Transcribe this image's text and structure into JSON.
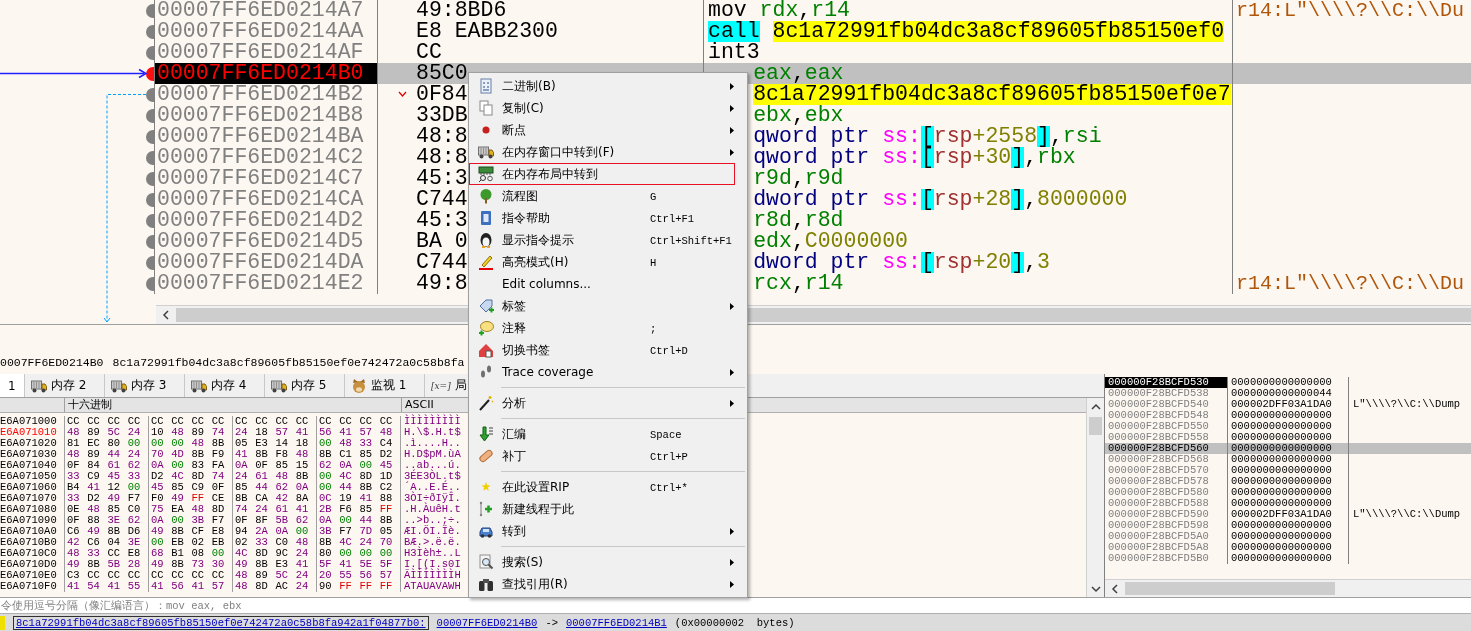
{
  "disassembly": {
    "rows": [
      {
        "address": "00007FF6ED0214A7",
        "bytes": "49:8BD6",
        "selected": false,
        "jump": false,
        "mnemonic": {
          "text": "mov",
          "kind": "plain"
        },
        "operands": [
          {
            "text": "rdx",
            "kind": "reg"
          },
          {
            "text": ",",
            "kind": "punct"
          },
          {
            "text": "r14",
            "kind": "reg"
          }
        ],
        "comment": "r14:L\"\\\\\\\\?\\\\C:\\\\Du"
      },
      {
        "address": "00007FF6ED0214AA",
        "bytes": "E8 EABB2300",
        "selected": false,
        "jump": false,
        "mnemonic": {
          "text": "call",
          "kind": "call"
        },
        "operands": [
          {
            "text": "8c1a72991fb04dc3a8cf89605fb85150ef0",
            "kind": "target"
          }
        ]
      },
      {
        "address": "00007FF6ED0214AF",
        "bytes": "CC",
        "selected": false,
        "jump": false,
        "mnemonic": {
          "text": "int3",
          "kind": "plain"
        }
      },
      {
        "address": "00007FF6ED0214B0",
        "bytes": "85C0",
        "selected": true,
        "jump": false,
        "operands": [
          {
            "text": "eax",
            "kind": "reg"
          },
          {
            "text": ",",
            "kind": "punct"
          },
          {
            "text": "eax",
            "kind": "reg"
          }
        ]
      },
      {
        "address": "00007FF6ED0214B2",
        "bytes": "0F84",
        "selected": false,
        "jump": true,
        "operands": [
          {
            "text": "8c1a72991fb04dc3a8cf89605fb85150ef0e7",
            "kind": "target"
          }
        ]
      },
      {
        "address": "00007FF6ED0214B8",
        "bytes": "33DB",
        "selected": false,
        "jump": false,
        "operands": [
          {
            "text": "ebx",
            "kind": "reg"
          },
          {
            "text": ",",
            "kind": "punct"
          },
          {
            "text": "ebx",
            "kind": "reg"
          }
        ]
      },
      {
        "address": "00007FF6ED0214BA",
        "bytes": "48:8",
        "selected": false,
        "jump": false,
        "operands": [
          {
            "text": "qword ptr ",
            "kind": "size"
          },
          {
            "text": "ss:",
            "kind": "seg"
          },
          {
            "text": "[",
            "kind": "bracket"
          },
          {
            "text": "rsp",
            "kind": "memreg"
          },
          {
            "text": "+2558",
            "kind": "num"
          },
          {
            "text": "]",
            "kind": "bracket"
          },
          {
            "text": ",",
            "kind": "punct"
          },
          {
            "text": "rsi",
            "kind": "reg"
          }
        ]
      },
      {
        "address": "00007FF6ED0214C2",
        "bytes": "48:8",
        "selected": false,
        "jump": false,
        "operands": [
          {
            "text": "qword ptr ",
            "kind": "size"
          },
          {
            "text": "ss:",
            "kind": "seg"
          },
          {
            "text": "[",
            "kind": "bracket"
          },
          {
            "text": "rsp",
            "kind": "memreg"
          },
          {
            "text": "+30",
            "kind": "num"
          },
          {
            "text": "]",
            "kind": "bracket"
          },
          {
            "text": ",",
            "kind": "punct"
          },
          {
            "text": "rbx",
            "kind": "reg"
          }
        ]
      },
      {
        "address": "00007FF6ED0214C7",
        "bytes": "45:3",
        "selected": false,
        "jump": false,
        "operands": [
          {
            "text": "r9d",
            "kind": "reg"
          },
          {
            "text": ",",
            "kind": "punct"
          },
          {
            "text": "r9d",
            "kind": "reg"
          }
        ]
      },
      {
        "address": "00007FF6ED0214CA",
        "bytes": "C744",
        "selected": false,
        "jump": false,
        "operands": [
          {
            "text": "dword ptr ",
            "kind": "size"
          },
          {
            "text": "ss:",
            "kind": "seg"
          },
          {
            "text": "[",
            "kind": "bracket"
          },
          {
            "text": "rsp",
            "kind": "memreg"
          },
          {
            "text": "+28",
            "kind": "num"
          },
          {
            "text": "]",
            "kind": "bracket"
          },
          {
            "text": ",",
            "kind": "punct"
          },
          {
            "text": "8000000",
            "kind": "num"
          }
        ]
      },
      {
        "address": "00007FF6ED0214D2",
        "bytes": "45:3",
        "selected": false,
        "jump": false,
        "operands": [
          {
            "text": "r8d",
            "kind": "reg"
          },
          {
            "text": ",",
            "kind": "punct"
          },
          {
            "text": "r8d",
            "kind": "reg"
          }
        ]
      },
      {
        "address": "00007FF6ED0214D5",
        "bytes": "BA 0",
        "selected": false,
        "jump": false,
        "operands": [
          {
            "text": "edx",
            "kind": "reg"
          },
          {
            "text": ",",
            "kind": "punct"
          },
          {
            "text": "C0000000",
            "kind": "num"
          }
        ]
      },
      {
        "address": "00007FF6ED0214DA",
        "bytes": "C744",
        "selected": false,
        "jump": false,
        "operands": [
          {
            "text": "dword ptr ",
            "kind": "size"
          },
          {
            "text": "ss:",
            "kind": "seg"
          },
          {
            "text": "[",
            "kind": "bracket"
          },
          {
            "text": "rsp",
            "kind": "memreg"
          },
          {
            "text": "+20",
            "kind": "num"
          },
          {
            "text": "]",
            "kind": "bracket"
          },
          {
            "text": ",",
            "kind": "punct"
          },
          {
            "text": "3",
            "kind": "num"
          }
        ]
      },
      {
        "address": "00007FF6ED0214E2",
        "bytes": "49:8",
        "selected": false,
        "jump": false,
        "operands": [
          {
            "text": "rcx",
            "kind": "reg"
          },
          {
            "text": ",",
            "kind": "punct"
          },
          {
            "text": "r14",
            "kind": "reg"
          }
        ],
        "comment": "r14:L\"\\\\\\\\?\\\\C:\\\\Du"
      }
    ]
  },
  "info": {
    "address": "0007FF6ED0214B0",
    "label": "8c1a72991fb04dc3a8cf89605fb85150ef0e742472a0c58b8fa"
  },
  "tabs": [
    {
      "label": "1",
      "kind": "plain",
      "selected": true
    },
    {
      "label": "内存 2",
      "kind": "memory",
      "selected": false
    },
    {
      "label": "内存 3",
      "kind": "memory",
      "selected": false
    },
    {
      "label": "内存 4",
      "kind": "memory",
      "selected": false
    },
    {
      "label": "内存 5",
      "kind": "memory",
      "selected": false
    },
    {
      "label": "监视 1",
      "kind": "watch",
      "selected": false
    },
    {
      "label": "局",
      "kind": "locals",
      "icon_text": "[x=]",
      "selected": false
    }
  ],
  "dump": {
    "columns": {
      "hex": "十六进制",
      "ascii": "ASCII"
    },
    "rows": [
      {
        "address": "E6A071000",
        "highlighted": false,
        "bytes": "CC CC CC CC CC CC CC CC CC CC CC CC CC CC CC CC",
        "ascii": "ÌÌÌÌÌÌÌÌÌ"
      },
      {
        "address": "E6A071010",
        "highlighted": true,
        "bytes": "48 89 5C 24 10 48 89 74 24 18 57 41 56 41 57 48",
        "ascii": "H.\\$.H.t$"
      },
      {
        "address": "E6A071020",
        "highlighted": false,
        "bytes": "81 EC 80 00 00 00 48 8B 05 E3 14 18 00 48 33 C4",
        "ascii": ".ì....H.."
      },
      {
        "address": "E6A071030",
        "highlighted": false,
        "bytes": "48 89 44 24 70 4D 8B F9 41 8B F8 48 8B C1 85 D2",
        "ascii": "H.D$pM.ùA"
      },
      {
        "address": "E6A071040",
        "highlighted": false,
        "bytes": "0F 84 61 62 0A 00 83 FA 0A 0F 85 15 62 0A 00 45",
        "ascii": "..ab...ú."
      },
      {
        "address": "E6A071050",
        "highlighted": false,
        "bytes": "33 C9 45 33 D2 4C 8D 74 24 61 48 8B 00 4C 8D 1D",
        "ascii": "3ÉE3ÒL.t$"
      },
      {
        "address": "E6A071060",
        "highlighted": false,
        "bytes": "B4 41 12 00 45 85 C9 0F 85 44 62 0A 00 44 8B C2",
        "ascii": "´A..E.É.."
      },
      {
        "address": "E6A071070",
        "highlighted": false,
        "bytes": "33 D2 49 F7 F0 49 FF CE 8B CA 42 8A 0C 19 41 88",
        "ascii": "3ÒI÷ðIÿÎ."
      },
      {
        "address": "E6A071080",
        "highlighted": false,
        "bytes": "0E 48 85 C0 75 EA 48 8D 74 24 61 41 2B F6 85 FF",
        "ascii": ".H.ÀuêH.t"
      },
      {
        "address": "E6A071090",
        "highlighted": false,
        "bytes": "0F 88 3E 62 0A 00 3B F7 0F 8F 5B 62 0A 00 44 8B",
        "ascii": "..>b..;÷."
      },
      {
        "address": "E6A0710A0",
        "highlighted": false,
        "bytes": "C6 49 8B D6 49 8B CF E8 94 2A 0A 00 3B F7 7D 05",
        "ascii": "ÆI.ÖI.Ïè."
      },
      {
        "address": "E6A0710B0",
        "highlighted": false,
        "bytes": "42 C6 04 3E 00 EB 02 EB 02 33 C0 48 8B 4C 24 70",
        "ascii": "BÆ.>.ë.ë."
      },
      {
        "address": "E6A0710C0",
        "highlighted": false,
        "bytes": "48 33 CC E8 68 B1 08 00 4C 8D 9C 24 80 00 00 00",
        "ascii": "H3Ìèh±..L"
      },
      {
        "address": "E6A0710D0",
        "highlighted": false,
        "bytes": "49 8B 5B 28 49 8B 73 30 49 8B E3 41 5F 41 5E 5F",
        "ascii": "I.[(I.s0I"
      },
      {
        "address": "E6A0710E0",
        "highlighted": false,
        "bytes": "C3 CC CC CC CC CC CC CC 48 89 5C 24 20 55 56 57",
        "ascii": "ÃÌÌÌÌÌÌÌH"
      },
      {
        "address": "E6A0710F0",
        "highlighted": false,
        "bytes": "41 54 41 55 41 56 41 57 48 8D AC 24 90 FF FF FF",
        "ascii": "ATAUAVAWH"
      }
    ]
  },
  "stack": {
    "rows": [
      {
        "address": "000000F28BCFD530",
        "value": "0000000000000000",
        "kind": "top"
      },
      {
        "address": "000000F28BCFD538",
        "value": "0000000000000044",
        "kind": "normal"
      },
      {
        "address": "000000F28BCFD540",
        "value": "000002DFF03A1DA0",
        "kind": "normal",
        "comment": "L\"\\\\\\\\?\\\\C:\\\\Dump"
      },
      {
        "address": "000000F28BCFD548",
        "value": "0000000000000000",
        "kind": "normal"
      },
      {
        "address": "000000F28BCFD550",
        "value": "0000000000000000",
        "kind": "normal"
      },
      {
        "address": "000000F28BCFD558",
        "value": "0000000000000000",
        "kind": "normal"
      },
      {
        "address": "000000F28BCFD560",
        "value": "0000000000000000",
        "kind": "current"
      },
      {
        "address": "000000F28BCFD568",
        "value": "0000000000000000",
        "kind": "normal"
      },
      {
        "address": "000000F28BCFD570",
        "value": "0000000000000000",
        "kind": "normal"
      },
      {
        "address": "000000F28BCFD578",
        "value": "0000000000000000",
        "kind": "normal"
      },
      {
        "address": "000000F28BCFD580",
        "value": "0000000000000000",
        "kind": "normal"
      },
      {
        "address": "000000F28BCFD588",
        "value": "0000000000000000",
        "kind": "normal"
      },
      {
        "address": "000000F28BCFD590",
        "value": "000002DFF03A1DA0",
        "kind": "normal",
        "comment": "L\"\\\\\\\\?\\\\C:\\\\Dump"
      },
      {
        "address": "000000F28BCFD598",
        "value": "0000000000000000",
        "kind": "normal"
      },
      {
        "address": "000000F28BCFD5A0",
        "value": "0000000000000000",
        "kind": "normal"
      },
      {
        "address": "000000F28BCFD5A8",
        "value": "0000000000000000",
        "kind": "normal"
      },
      {
        "address": "000000F28BCFD5B0",
        "value": "0000000000000000",
        "kind": "normal"
      }
    ]
  },
  "command": {
    "placeholder": "令使用逗号分隔（像汇编语言）：mov eax, ebx"
  },
  "status_bar": {
    "label": "8c1a72991fb04dc3a8cf89605fb85150ef0e742472a0c58b8fa942a1f04877b0:",
    "from": "00007FF6ED0214B0",
    "arrow": "->",
    "to": "00007FF6ED0214B1",
    "size": "(0x00000002  bytes)"
  },
  "menu": {
    "items": [
      {
        "kind": "item",
        "label": "二进制(B)",
        "submenu": true,
        "selected": false
      },
      {
        "kind": "item",
        "label": "复制(C)",
        "submenu": true,
        "selected": false
      },
      {
        "kind": "item",
        "label": "断点",
        "submenu": true,
        "selected": false
      },
      {
        "kind": "item",
        "label": "在内存窗口中转到(F)",
        "submenu": true,
        "selected": false
      },
      {
        "kind": "item",
        "label": "在内存布局中转到",
        "submenu": false,
        "selected": true
      },
      {
        "kind": "item",
        "label": "流程图",
        "shortcut": "G",
        "submenu": false,
        "selected": false
      },
      {
        "kind": "item",
        "label": "指令帮助",
        "shortcut": "Ctrl+F1",
        "submenu": false,
        "selected": false
      },
      {
        "kind": "item",
        "label": "显示指令提示",
        "shortcut": "Ctrl+Shift+F1",
        "submenu": false,
        "selected": false
      },
      {
        "kind": "item",
        "label": "高亮模式(H)",
        "shortcut": "H",
        "submenu": false,
        "selected": false
      },
      {
        "kind": "item",
        "label": "Edit columns...",
        "submenu": false,
        "selected": false
      },
      {
        "kind": "item",
        "label": "标签",
        "submenu": true,
        "selected": false
      },
      {
        "kind": "item",
        "label": "注释",
        "shortcut": ";",
        "submenu": false,
        "selected": false
      },
      {
        "kind": "item",
        "label": "切换书签",
        "shortcut": "Ctrl+D",
        "submenu": false,
        "selected": false
      },
      {
        "kind": "item",
        "label": "Trace coverage",
        "submenu": true,
        "selected": false
      },
      {
        "kind": "separator"
      },
      {
        "kind": "item",
        "label": "分析",
        "submenu": true,
        "selected": false
      },
      {
        "kind": "separator"
      },
      {
        "kind": "item",
        "label": "汇编",
        "shortcut": "Space",
        "submenu": false,
        "selected": false
      },
      {
        "kind": "item",
        "label": "补丁",
        "shortcut": "Ctrl+P",
        "submenu": false,
        "selected": false
      },
      {
        "kind": "separator"
      },
      {
        "kind": "item",
        "label": "在此设置RIP",
        "shortcut": "Ctrl+*",
        "submenu": false,
        "selected": false
      },
      {
        "kind": "item",
        "label": "新建线程于此",
        "submenu": false,
        "selected": false
      },
      {
        "kind": "item",
        "label": "转到",
        "submenu": true,
        "selected": false
      },
      {
        "kind": "separator"
      },
      {
        "kind": "item",
        "label": "搜索(S)",
        "submenu": true,
        "selected": false
      },
      {
        "kind": "item",
        "label": "查找引用(R)",
        "submenu": true,
        "selected": false
      }
    ]
  }
}
